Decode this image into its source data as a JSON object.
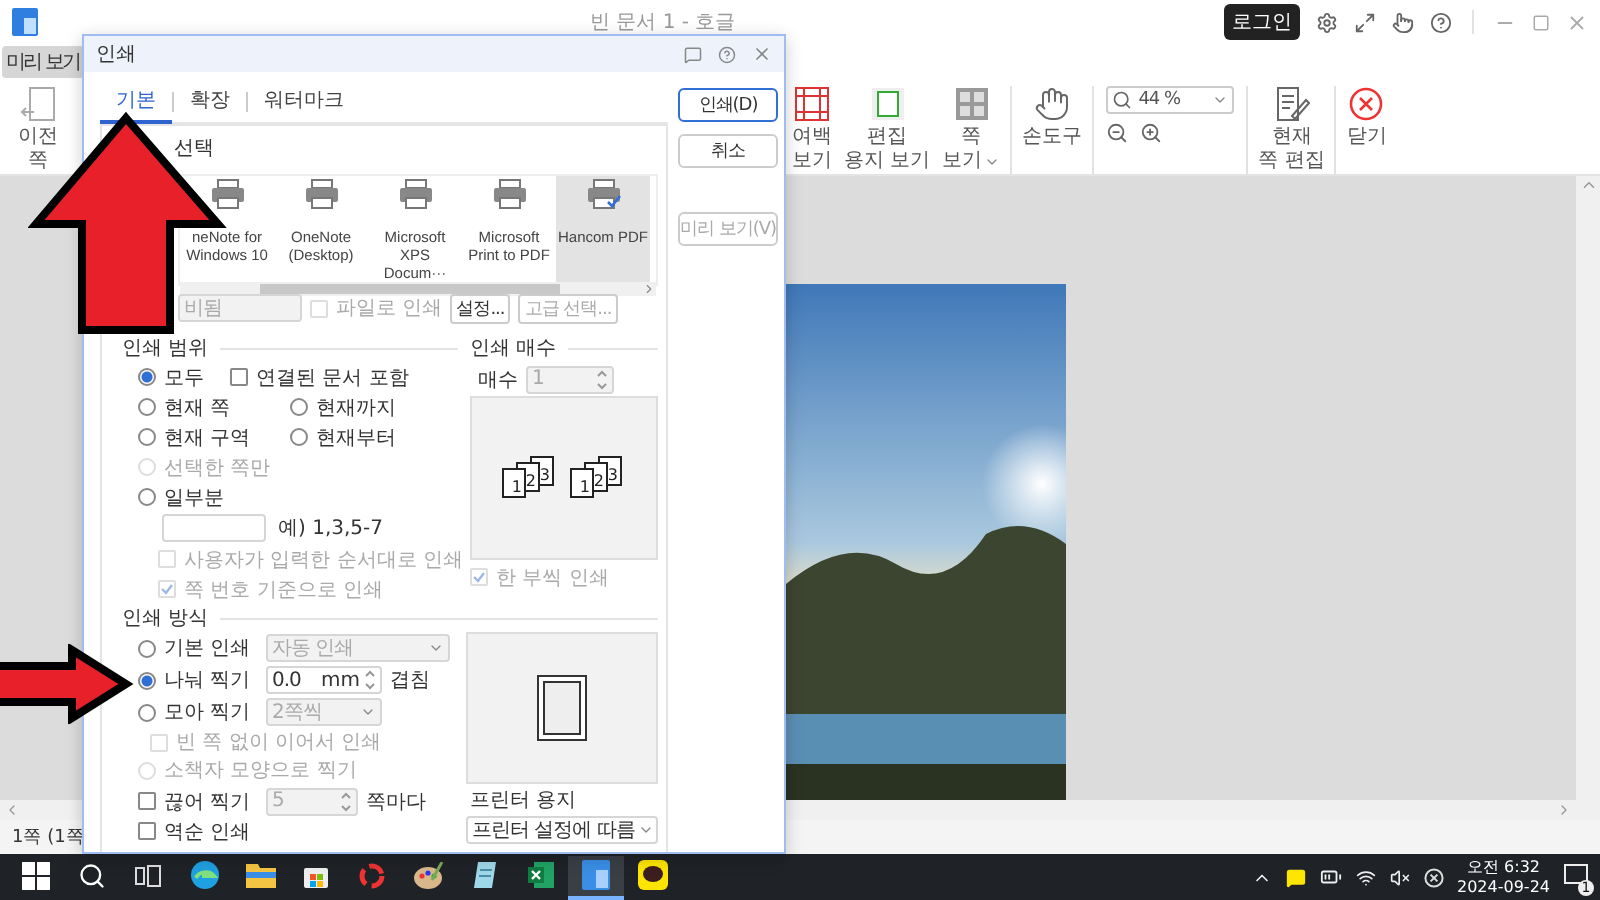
{
  "app": {
    "title": "빈 문서 1 - 호글",
    "login": "로그인",
    "menu_tab": "미리 보기"
  },
  "ribbon_left": [
    {
      "kind": "prev",
      "lines": [
        "이전",
        "쪽"
      ]
    }
  ],
  "ribbon_right": [
    {
      "kind": "margin",
      "lines": [
        "여백",
        "보기"
      ]
    },
    {
      "kind": "paper",
      "lines": [
        "편집",
        "용지 보기"
      ]
    },
    {
      "kind": "pageview",
      "lines": [
        "쪽",
        "보기"
      ],
      "caret": true
    },
    {
      "kind": "hand",
      "lines": [
        "손도구"
      ]
    },
    {
      "kind": "zoom",
      "value": "44 %"
    },
    {
      "kind": "edit",
      "lines": [
        "현재",
        "쪽 편집"
      ]
    },
    {
      "kind": "close",
      "lines": [
        "닫기"
      ]
    }
  ],
  "status_bar": {
    "page": "1쪽 (1쪽"
  },
  "dialog": {
    "title": "인쇄",
    "tabs": [
      {
        "label": "기본",
        "selected": true
      },
      {
        "label": "확장",
        "selected": false
      },
      {
        "label": "워터마크",
        "selected": false
      }
    ],
    "buttons": [
      {
        "label": "인쇄(D)",
        "kind": "primary",
        "disabled": false
      },
      {
        "label": "취소",
        "kind": "normal",
        "disabled": false
      },
      {
        "label": "미리 보기(V)",
        "kind": "normal",
        "disabled": true
      }
    ],
    "printer": {
      "title": "선택",
      "printers": [
        {
          "name": "neNote for Windows 10",
          "selected": false
        },
        {
          "name": "OneNote (Desktop)",
          "selected": false
        },
        {
          "name": "Microsoft XPS Docum···",
          "selected": false
        },
        {
          "name": "Microsoft Print to PDF",
          "selected": false
        },
        {
          "name": "Hancom PDF",
          "selected": true
        }
      ],
      "status": "비됨",
      "print_to_file": {
        "label": "파일로 인쇄",
        "checked": false,
        "disabled": true
      },
      "settings_button": "설정...",
      "advanced_button": "고급 선택..."
    },
    "range": {
      "title": "인쇄 범위",
      "options": [
        {
          "label": "모두",
          "selected": true,
          "disabled": false
        },
        {
          "label": "현재 쪽",
          "selected": false,
          "disabled": false
        },
        {
          "label": "현재까지",
          "selected": false,
          "disabled": false
        },
        {
          "label": "현재 구역",
          "selected": false,
          "disabled": false
        },
        {
          "label": "현재부터",
          "selected": false,
          "disabled": false
        },
        {
          "label": "선택한 쪽만",
          "selected": false,
          "disabled": true
        },
        {
          "label": "일부분",
          "selected": false,
          "disabled": false
        }
      ],
      "include_linked": {
        "label": "연결된 문서 포함",
        "checked": false,
        "disabled": false
      },
      "example": "예) 1,3,5-7",
      "ordered": {
        "label": "사용자가 입력한 순서대로 인쇄",
        "checked": false,
        "disabled": true
      },
      "by_page_number": {
        "label": "쪽 번호 기준으로 인쇄",
        "checked": true,
        "disabled": true
      }
    },
    "copies": {
      "title": "인쇄 매수",
      "label": "매수",
      "value": "1",
      "collate_sets": [
        [
          "1",
          "2",
          "3"
        ],
        [
          "1",
          "2",
          "3"
        ]
      ],
      "collate": {
        "label": "한 부씩 인쇄",
        "checked": true,
        "disabled": true
      }
    },
    "method": {
      "title": "인쇄 방식",
      "options": [
        {
          "label": "기본 인쇄",
          "selected": false,
          "disabled": false
        },
        {
          "label": "나눠 찍기",
          "selected": true,
          "disabled": false
        },
        {
          "label": "모아 찍기",
          "selected": false,
          "disabled": false
        },
        {
          "label": "소책자 모양으로 찍기",
          "selected": false,
          "disabled": true
        }
      ],
      "basic_select": "자동 인쇄",
      "split_value": "0.0",
      "split_unit": "mm",
      "split_suffix": "겹침",
      "gather_select": "2쪽씩",
      "no_blank": {
        "label": "빈 쪽 없이 이어서 인쇄",
        "checked": false,
        "disabled": true
      },
      "cut": {
        "label": "끊어 찍기",
        "checked": false,
        "disabled": false
      },
      "cut_value": "5",
      "cut_suffix": "쪽마다",
      "reverse": {
        "label": "역순 인쇄",
        "checked": false,
        "disabled": false
      },
      "paper_title": "프린터 용지",
      "paper_select": "프린터 설정에 따름"
    }
  },
  "taskbar": {
    "apps": [
      {
        "kind": "start",
        "active": false
      },
      {
        "kind": "search",
        "active": false
      },
      {
        "kind": "taskview",
        "active": false
      },
      {
        "kind": "edge",
        "active": false
      },
      {
        "kind": "explorer",
        "active": false
      },
      {
        "kind": "store",
        "active": false
      },
      {
        "kind": "ring",
        "active": false
      },
      {
        "kind": "paint",
        "active": false
      },
      {
        "kind": "notepad",
        "active": false
      },
      {
        "kind": "excel",
        "active": false
      },
      {
        "kind": "hancom",
        "active": true
      },
      {
        "kind": "chat",
        "active": false
      }
    ],
    "time": "오전 6:32",
    "date": "2024-09-24",
    "notifications": "1"
  }
}
